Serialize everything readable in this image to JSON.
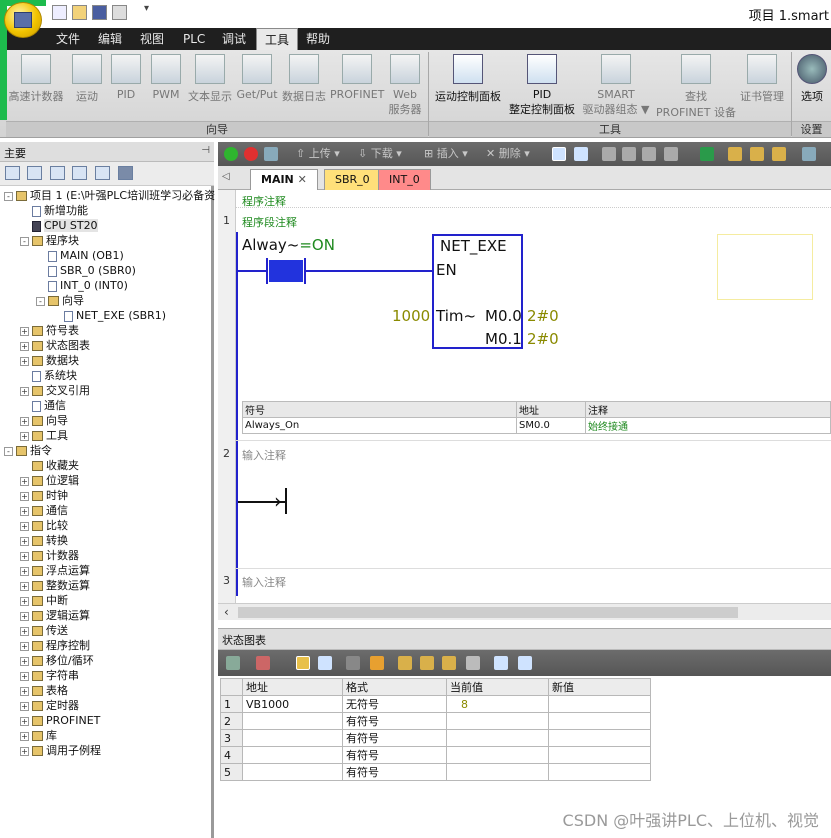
{
  "window": {
    "title": "项目 1.smart"
  },
  "menu": [
    "文件",
    "编辑",
    "视图",
    "PLC",
    "调试",
    "工具",
    "帮助"
  ],
  "ribbon": {
    "wizard_buttons": [
      {
        "label": "高速计数器",
        "icon": "counter-wizard-icon"
      },
      {
        "label": "运动",
        "icon": "motion-wizard-icon"
      },
      {
        "label": "PID",
        "icon": "pid-wizard-icon"
      },
      {
        "label": "PWM",
        "icon": "pwm-wizard-icon"
      },
      {
        "label": "文本显示",
        "icon": "text-display-icon"
      },
      {
        "label": "Get/Put",
        "icon": "getput-icon"
      },
      {
        "label": "数据日志",
        "icon": "data-log-icon"
      },
      {
        "label": "PROFINET",
        "icon": "profinet-icon"
      },
      {
        "label": "Web",
        "label2": "服务器",
        "icon": "web-server-icon"
      }
    ],
    "tool_buttons": [
      {
        "label": "运动控制面板",
        "icon": "motion-panel-icon"
      },
      {
        "label": "PID",
        "label2": "整定控制面板",
        "icon": "pid-tuning-icon"
      },
      {
        "label": "SMART",
        "label2": "驱动器组态 ▼",
        "icon": "drive-config-icon"
      },
      {
        "label": "查找",
        "label2": "PROFINET 设备",
        "icon": "find-device-icon"
      },
      {
        "label": "证书管理",
        "icon": "certificate-icon"
      }
    ],
    "settings_button": {
      "label": "选项",
      "icon": "gears-icon"
    },
    "groups": [
      "向导",
      "工具",
      "设置"
    ]
  },
  "left_panel": {
    "title": "主要",
    "tree": [
      {
        "label": "项目 1 (E:\\叶强PLC培训班学习必备资",
        "indent": 0,
        "tog": "-",
        "kind": "proj"
      },
      {
        "label": "新增功能",
        "indent": 1,
        "tog": "",
        "kind": "page"
      },
      {
        "label": "CPU ST20",
        "indent": 1,
        "tog": "",
        "kind": "cpu",
        "selected": true
      },
      {
        "label": "程序块",
        "indent": 1,
        "tog": "-",
        "kind": "folder"
      },
      {
        "label": "MAIN (OB1)",
        "indent": 2,
        "tog": "",
        "kind": "page"
      },
      {
        "label": "SBR_0 (SBR0)",
        "indent": 2,
        "tog": "",
        "kind": "page"
      },
      {
        "label": "INT_0 (INT0)",
        "indent": 2,
        "tog": "",
        "kind": "page"
      },
      {
        "label": "向导",
        "indent": 2,
        "tog": "-",
        "kind": "folder"
      },
      {
        "label": "NET_EXE (SBR1)",
        "indent": 3,
        "tog": "",
        "kind": "page"
      },
      {
        "label": "符号表",
        "indent": 1,
        "tog": "+",
        "kind": "folder"
      },
      {
        "label": "状态图表",
        "indent": 1,
        "tog": "+",
        "kind": "folder"
      },
      {
        "label": "数据块",
        "indent": 1,
        "tog": "+",
        "kind": "folder"
      },
      {
        "label": "系统块",
        "indent": 1,
        "tog": "",
        "kind": "page"
      },
      {
        "label": "交叉引用",
        "indent": 1,
        "tog": "+",
        "kind": "folder"
      },
      {
        "label": "通信",
        "indent": 1,
        "tog": "",
        "kind": "page"
      },
      {
        "label": "向导",
        "indent": 1,
        "tog": "+",
        "kind": "folder"
      },
      {
        "label": "工具",
        "indent": 1,
        "tog": "+",
        "kind": "folder"
      },
      {
        "label": "指令",
        "indent": 0,
        "tog": "-",
        "kind": "folder"
      },
      {
        "label": "收藏夹",
        "indent": 1,
        "tog": "",
        "kind": "folder"
      },
      {
        "label": "位逻辑",
        "indent": 1,
        "tog": "+",
        "kind": "folder"
      },
      {
        "label": "时钟",
        "indent": 1,
        "tog": "+",
        "kind": "folder"
      },
      {
        "label": "通信",
        "indent": 1,
        "tog": "+",
        "kind": "folder"
      },
      {
        "label": "比较",
        "indent": 1,
        "tog": "+",
        "kind": "folder"
      },
      {
        "label": "转换",
        "indent": 1,
        "tog": "+",
        "kind": "folder"
      },
      {
        "label": "计数器",
        "indent": 1,
        "tog": "+",
        "kind": "folder"
      },
      {
        "label": "浮点运算",
        "indent": 1,
        "tog": "+",
        "kind": "folder"
      },
      {
        "label": "整数运算",
        "indent": 1,
        "tog": "+",
        "kind": "folder"
      },
      {
        "label": "中断",
        "indent": 1,
        "tog": "+",
        "kind": "folder"
      },
      {
        "label": "逻辑运算",
        "indent": 1,
        "tog": "+",
        "kind": "folder"
      },
      {
        "label": "传送",
        "indent": 1,
        "tog": "+",
        "kind": "folder"
      },
      {
        "label": "程序控制",
        "indent": 1,
        "tog": "+",
        "kind": "folder"
      },
      {
        "label": "移位/循环",
        "indent": 1,
        "tog": "+",
        "kind": "folder"
      },
      {
        "label": "字符串",
        "indent": 1,
        "tog": "+",
        "kind": "folder"
      },
      {
        "label": "表格",
        "indent": 1,
        "tog": "+",
        "kind": "folder"
      },
      {
        "label": "定时器",
        "indent": 1,
        "tog": "+",
        "kind": "folder"
      },
      {
        "label": "PROFINET",
        "indent": 1,
        "tog": "+",
        "kind": "folder"
      },
      {
        "label": "库",
        "indent": 1,
        "tog": "+",
        "kind": "folder"
      },
      {
        "label": "调用子例程",
        "indent": 1,
        "tog": "+",
        "kind": "folder"
      }
    ]
  },
  "editor_toolbar": {
    "upload": "上传",
    "download": "下载",
    "insert": "插入",
    "delete": "删除"
  },
  "tabs": [
    "MAIN",
    "SBR_0",
    "INT_0"
  ],
  "program": {
    "program_comment": "程序注释",
    "networks": [
      {
        "number": "1",
        "comment": "程序段注释",
        "contact_label": "Alway~",
        "contact_state": "=ON",
        "box_title": "NET_EXE",
        "en": "EN",
        "tim_value": "1000",
        "tim_label": "Tim~",
        "out1": "M0.0",
        "out1_val": "2#0",
        "out2": "M0.1",
        "out2_val": "2#0",
        "symbol_table": {
          "headers": [
            "符号",
            "地址",
            "注释"
          ],
          "rows": [
            [
              "Always_On",
              "SM0.0",
              "始终接通"
            ]
          ]
        }
      },
      {
        "number": "2",
        "comment": "输入注释"
      },
      {
        "number": "3",
        "comment": "输入注释"
      }
    ]
  },
  "status_chart": {
    "title": "状态图表",
    "headers": [
      "地址",
      "格式",
      "当前值",
      "新值"
    ],
    "rows": [
      {
        "idx": "1",
        "addr": "VB1000",
        "fmt": "无符号",
        "cur": "8",
        "new": ""
      },
      {
        "idx": "2",
        "addr": "",
        "fmt": "有符号",
        "cur": "",
        "new": ""
      },
      {
        "idx": "3",
        "addr": "",
        "fmt": "有符号",
        "cur": "",
        "new": ""
      },
      {
        "idx": "4",
        "addr": "",
        "fmt": "有符号",
        "cur": "",
        "new": ""
      },
      {
        "idx": "5",
        "addr": "",
        "fmt": "有符号",
        "cur": "",
        "new": ""
      }
    ]
  },
  "watermark": "CSDN @叶强讲PLC、上位机、视觉",
  "colors": {
    "accent": "#2222cc",
    "green_text": "#1f8a1f",
    "olive_text": "#8a8a00"
  }
}
